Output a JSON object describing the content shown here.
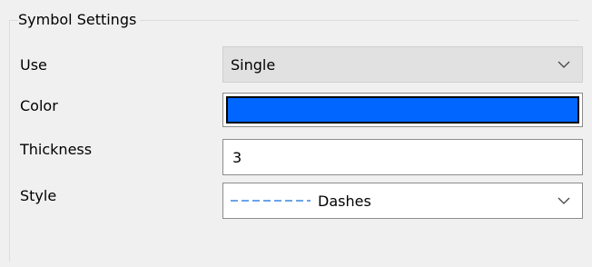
{
  "group": {
    "title": "Symbol Settings"
  },
  "use": {
    "label": "Use",
    "selected": "Single"
  },
  "color": {
    "label": "Color",
    "value": "#0066ff"
  },
  "thickness": {
    "label": "Thickness",
    "value": "3"
  },
  "style": {
    "label": "Style",
    "selected": "Dashes",
    "preview_color": "#3a86e0"
  },
  "icons": {
    "dropdown": "chevron-down-icon",
    "style_preview": "dashed-line-icon"
  }
}
